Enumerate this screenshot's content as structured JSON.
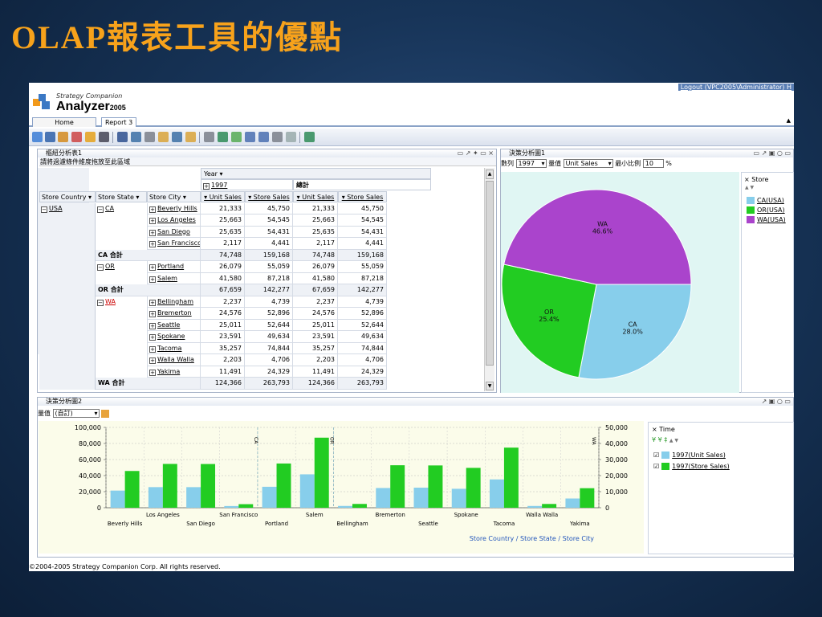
{
  "slide_title": "OLAP報表工具的優點",
  "app": {
    "logout": "Logout (VPC2005\\Administrator) H",
    "company": "Strategy Companion",
    "product": "Analyzer",
    "version": "2005",
    "tabs": [
      "Home",
      "Report 3"
    ],
    "toolbar_icons": [
      "chart-pie-icon",
      "grid-icon",
      "cube-icon",
      "wizard-icon",
      "database-icon",
      "sort-icon",
      "save-icon",
      "save-as-icon",
      "print-icon",
      "window-icon",
      "export-icon",
      "folder-icon",
      "pin-icon",
      "filter-icon",
      "document-icon",
      "zoom-in-icon",
      "zoom-out-icon",
      "list-icon",
      "table-icon",
      "exit-icon"
    ],
    "copyright": "©2004-2005 Strategy Companion Corp. All rights reserved."
  },
  "pivot": {
    "title": "樞紐分析表1",
    "drop_hint": "請將過濾條件維度拖放至此區域",
    "controls": "▭ ↗ ✦ ▭ ×",
    "year_label": "Year",
    "year_value": "1997",
    "total_label": "總計",
    "row_headers": [
      "Store Country",
      "Store State",
      "Store City"
    ],
    "measures": [
      "Unit Sales",
      "Store Sales",
      "Unit Sales",
      "Store Sales"
    ],
    "country": "USA",
    "rows": [
      {
        "state": "CA",
        "city": "Beverly Hills",
        "v": [
          "21,333",
          "45,750",
          "21,333",
          "45,750"
        ]
      },
      {
        "state": "",
        "city": "Los Angeles",
        "v": [
          "25,663",
          "54,545",
          "25,663",
          "54,545"
        ]
      },
      {
        "state": "",
        "city": "San Diego",
        "v": [
          "25,635",
          "54,431",
          "25,635",
          "54,431"
        ]
      },
      {
        "state": "",
        "city": "San Francisco",
        "v": [
          "2,117",
          "4,441",
          "2,117",
          "4,441"
        ]
      },
      {
        "subtotal": "CA 合計",
        "v": [
          "74,748",
          "159,168",
          "74,748",
          "159,168"
        ]
      },
      {
        "state": "OR",
        "city": "Portland",
        "v": [
          "26,079",
          "55,059",
          "26,079",
          "55,059"
        ]
      },
      {
        "state": "",
        "city": "Salem",
        "v": [
          "41,580",
          "87,218",
          "41,580",
          "87,218"
        ]
      },
      {
        "subtotal": "OR 合計",
        "v": [
          "67,659",
          "142,277",
          "67,659",
          "142,277"
        ]
      },
      {
        "state": "WA",
        "city": "Bellingham",
        "v": [
          "2,237",
          "4,739",
          "2,237",
          "4,739"
        ]
      },
      {
        "state": "",
        "city": "Bremerton",
        "v": [
          "24,576",
          "52,896",
          "24,576",
          "52,896"
        ]
      },
      {
        "state": "",
        "city": "Seattle",
        "v": [
          "25,011",
          "52,644",
          "25,011",
          "52,644"
        ]
      },
      {
        "state": "",
        "city": "Spokane",
        "v": [
          "23,591",
          "49,634",
          "23,591",
          "49,634"
        ]
      },
      {
        "state": "",
        "city": "Tacoma",
        "v": [
          "35,257",
          "74,844",
          "35,257",
          "74,844"
        ]
      },
      {
        "state": "",
        "city": "Walla Walla",
        "v": [
          "2,203",
          "4,706",
          "2,203",
          "4,706"
        ]
      },
      {
        "state": "",
        "city": "Yakima",
        "v": [
          "11,491",
          "24,329",
          "11,491",
          "24,329"
        ]
      },
      {
        "subtotal": "WA 合計",
        "v": [
          "124,366",
          "263,793",
          "124,366",
          "263,793"
        ]
      }
    ]
  },
  "pie": {
    "title": "決策分析圖1",
    "controls": "▭ ↗ ▣ ○ ▭",
    "series_label": "數列",
    "series_value": "1997",
    "measure_label": "量值",
    "measure_value": "Unit Sales",
    "min_ratio_label": "最小比例",
    "min_ratio_value": "10",
    "percent_sign": "%",
    "legend_title": "Store",
    "colors": {
      "CA": "#87ceeb",
      "OR": "#22cc22",
      "WA": "#aa44cc"
    }
  },
  "bar": {
    "title": "決策分析圖2",
    "controls": "↗ ▣ ○ ▭",
    "measure_label": "量值",
    "measure_value": "(自訂)",
    "legend_title": "Time",
    "axis_title": "Store Country / Store State / Store City",
    "colors": {
      "unit": "#87ceeb",
      "store": "#22cc22"
    }
  },
  "chart_data": [
    {
      "type": "pie",
      "categories": [
        "CA(USA)",
        "OR(USA)",
        "WA(USA)"
      ],
      "slice_labels": [
        "CA",
        "OR",
        "WA"
      ],
      "values": [
        28.0,
        25.4,
        46.6
      ],
      "value_labels": [
        "28.0%",
        "25.4%",
        "46.6%"
      ],
      "legend": [
        "CA(USA)",
        "OR(USA)",
        "WA(USA)"
      ],
      "legend_placement": "right"
    },
    {
      "type": "bar",
      "categories": [
        "Beverly Hills",
        "Los Angeles",
        "San Diego",
        "San Francisco",
        "Portland",
        "Salem",
        "Bellingham",
        "Bremerton",
        "Seattle",
        "Spokane",
        "Tacoma",
        "Walla Walla",
        "Yakima"
      ],
      "series": [
        {
          "name": "1997(Unit Sales)",
          "values": [
            21333,
            25663,
            25635,
            2117,
            26079,
            41580,
            2237,
            24576,
            25011,
            23591,
            35257,
            2203,
            11491
          ]
        },
        {
          "name": "1997(Store Sales)",
          "values": [
            45750,
            54545,
            54431,
            4441,
            55059,
            87218,
            4739,
            52896,
            52644,
            49634,
            74844,
            4706,
            24329
          ]
        }
      ],
      "xlabel": "Store Country / Store State / Store City",
      "ylim": [
        0,
        100000
      ],
      "yticks": [
        "100,000",
        "80,000",
        "60,000",
        "40,000",
        "20,000",
        "0"
      ],
      "y2lim": [
        0,
        50000
      ],
      "y2ticks": [
        "50,000",
        "40,000",
        "30,000",
        "20,000",
        "10,000",
        "0"
      ],
      "group_labels": [
        "CA",
        "OR",
        "WA"
      ],
      "grid": true,
      "legend_placement": "right"
    }
  ]
}
